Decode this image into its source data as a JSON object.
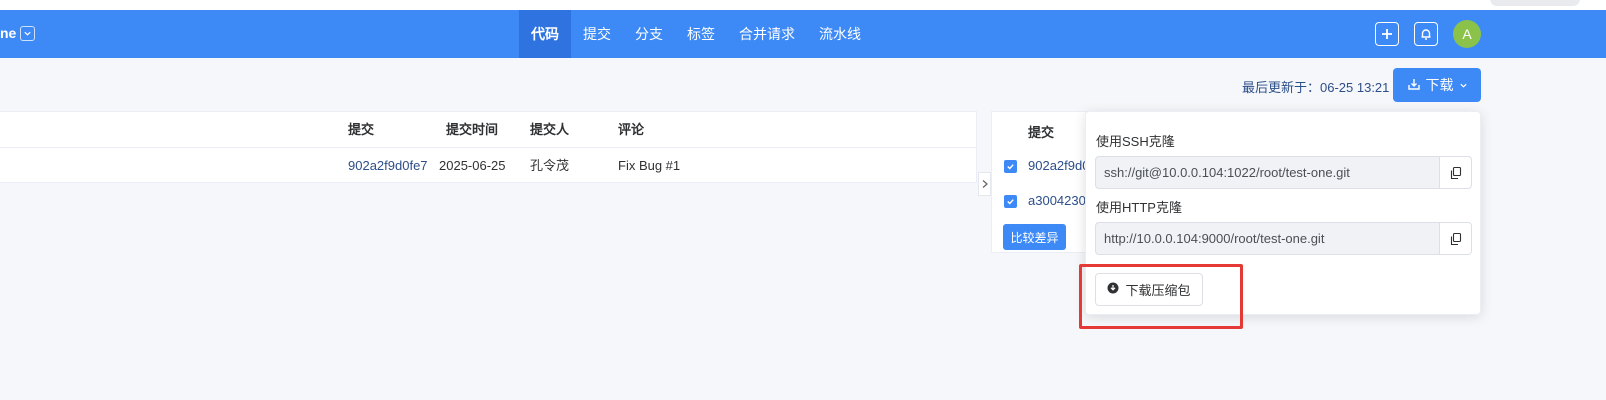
{
  "header": {
    "repo_name": "ne",
    "nav": [
      {
        "label": "代码",
        "active": true
      },
      {
        "label": "提交",
        "active": false
      },
      {
        "label": "分支",
        "active": false
      },
      {
        "label": "标签",
        "active": false
      },
      {
        "label": "合并请求",
        "active": false
      },
      {
        "label": "流水线",
        "active": false
      }
    ],
    "avatar_initial": "A",
    "icons": [
      "chevron-down-icon",
      "plus-icon",
      "bell-icon"
    ]
  },
  "toolbar": {
    "last_updated": "最后更新于：06-25 13:21",
    "download_label": "下载"
  },
  "commit_table": {
    "columns": [
      "提交",
      "提交时间",
      "提交人",
      "评论"
    ],
    "rows": [
      {
        "commit": "902a2f9d0fe7",
        "time": "2025-06-25",
        "author": "孔令茂",
        "comment": "Fix Bug #1"
      }
    ]
  },
  "compare_panel": {
    "title": "提交",
    "items": [
      {
        "hash": "902a2f9d0",
        "checked": true
      },
      {
        "hash": "a3004230.",
        "checked": true
      }
    ],
    "compare_label": "比较差异"
  },
  "download_popover": {
    "ssh_label": "使用SSH克隆",
    "ssh_url": "ssh://git@10.0.0.104:1022/root/test-one.git",
    "http_label": "使用HTTP克隆",
    "http_url": "http://10.0.0.104:9000/root/test-one.git",
    "zip_label": "下载压缩包"
  },
  "colors": {
    "primary": "#3d8af7",
    "nav_active": "#2f73e0",
    "link": "#2c4e8a",
    "avatar": "#8bc34a",
    "highlight": "#e53935"
  }
}
